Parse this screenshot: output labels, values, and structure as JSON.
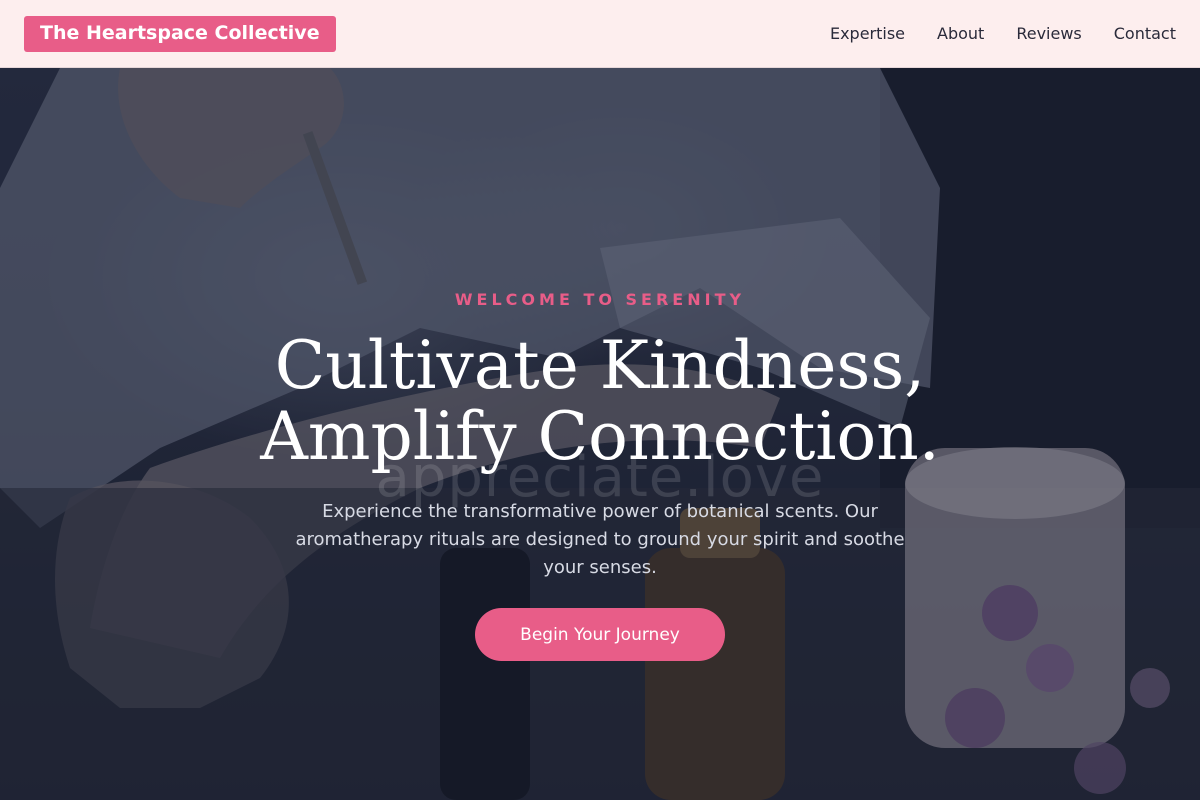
{
  "header": {
    "brand": "The Heartspace Collective",
    "nav": [
      "Expertise",
      "About",
      "Reviews",
      "Contact"
    ]
  },
  "hero": {
    "eyebrow": "WELCOME TO SERENITY",
    "headline_line1": "Cultivate Kindness,",
    "headline_line2": "Amplify Connection.",
    "watermark": "appreciate.love",
    "subtext": "Experience the transformative power of botanical scents. Our aromatherapy rituals are designed to ground your spirit and soothe your senses.",
    "cta_label": "Begin Your Journey"
  },
  "colors": {
    "accent": "#e85d88",
    "header_bg": "#fdeeee",
    "hero_bg": "#1c2233"
  }
}
